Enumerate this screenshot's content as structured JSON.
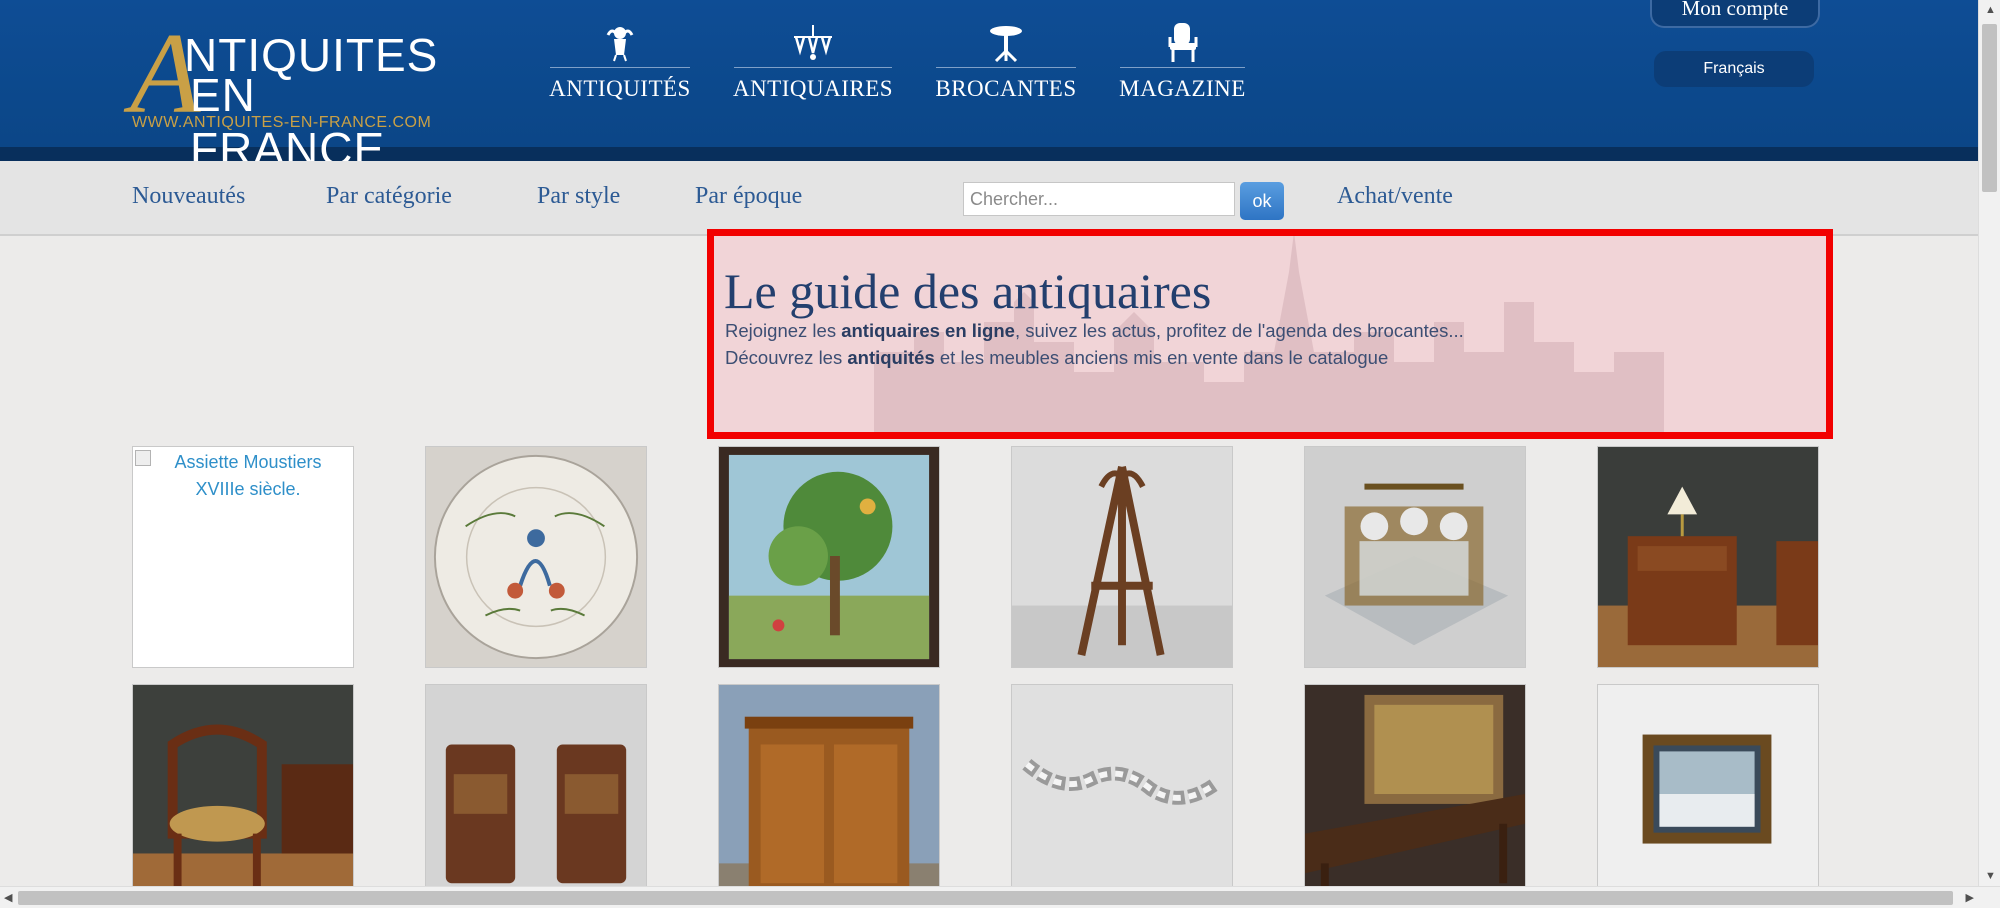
{
  "logo": {
    "line1": "NTIQUITES",
    "line2": "EN FRANCE",
    "big_letter": "A",
    "url": "WWW.ANTIQUITES-EN-FRANCE.COM"
  },
  "main_nav": [
    {
      "label": "ANTIQUITÉS",
      "icon": "cherub-icon"
    },
    {
      "label": "ANTIQUAIRES",
      "icon": "chandelier-icon"
    },
    {
      "label": "BROCANTES",
      "icon": "table-icon"
    },
    {
      "label": "MAGAZINE",
      "icon": "chair-icon"
    }
  ],
  "account": {
    "label": "Mon compte",
    "language": "Français"
  },
  "sub_nav": {
    "links": [
      "Nouveautés",
      "Par catégorie",
      "Par style",
      "Par époque"
    ],
    "search_placeholder": "Chercher...",
    "search_button": "ok",
    "achat_vente": "Achat/vente"
  },
  "guide": {
    "title": "Le guide des antiquaires",
    "line1_pre": "Rejoignez les ",
    "line1_bold": "antiquaires en ligne",
    "line1_post": ", suivez les actus, profitez de l'agenda des brocantes...",
    "line2_pre": "Découvrez les ",
    "line2_bold": "antiquités",
    "line2_post": " et les meubles anciens mis en vente dans le catalogue"
  },
  "gallery": {
    "broken_alt": "Assiette Moustiers XVIIIe siècle."
  },
  "colors": {
    "header_blue": "#0e4d95",
    "gold": "#c9a046",
    "link_blue": "#2c5a94",
    "highlight_red": "#f20000"
  }
}
